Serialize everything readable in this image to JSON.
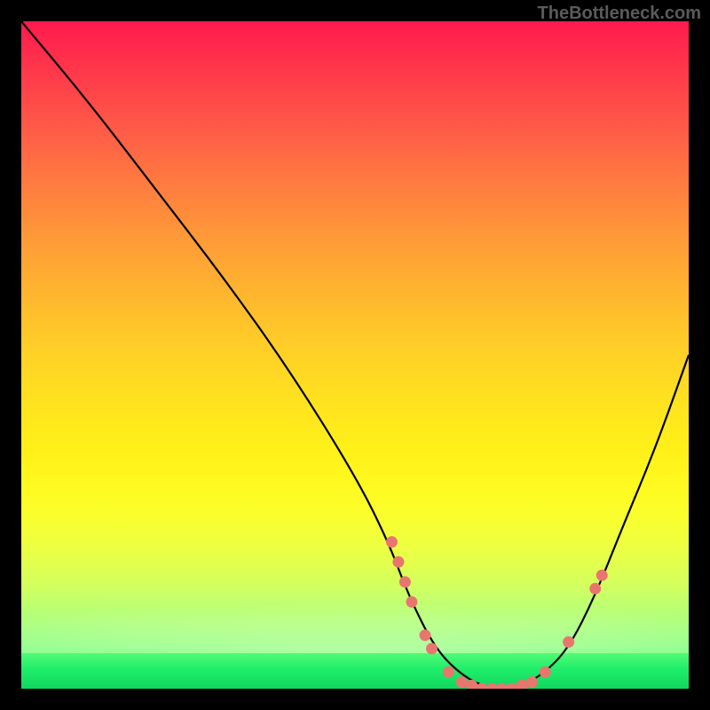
{
  "watermark": "TheBottleneck.com",
  "chart_data": {
    "type": "line",
    "title": "",
    "xlabel": "",
    "ylabel": "",
    "xlim": [
      0,
      100
    ],
    "ylim": [
      0,
      100
    ],
    "series": [
      {
        "name": "curve",
        "x": [
          0,
          10,
          20,
          30,
          40,
          50,
          55,
          58,
          62,
          66,
          70,
          74,
          78,
          82,
          86,
          90,
          95,
          100
        ],
        "y": [
          100,
          88,
          75,
          62,
          48,
          32,
          22,
          14,
          6,
          2,
          0,
          0,
          2,
          6,
          14,
          24,
          36,
          50
        ]
      }
    ],
    "points": [
      {
        "x": 55.5,
        "y": 22
      },
      {
        "x": 56.5,
        "y": 19
      },
      {
        "x": 57.5,
        "y": 16
      },
      {
        "x": 58.5,
        "y": 13
      },
      {
        "x": 60.5,
        "y": 8
      },
      {
        "x": 61.5,
        "y": 6
      },
      {
        "x": 64,
        "y": 2.5
      },
      {
        "x": 66,
        "y": 1
      },
      {
        "x": 67.5,
        "y": 0.5
      },
      {
        "x": 69,
        "y": 0
      },
      {
        "x": 70.5,
        "y": 0
      },
      {
        "x": 72,
        "y": 0
      },
      {
        "x": 73.5,
        "y": 0
      },
      {
        "x": 75,
        "y": 0.5
      },
      {
        "x": 76.5,
        "y": 1
      },
      {
        "x": 78.5,
        "y": 2.5
      },
      {
        "x": 82,
        "y": 7
      },
      {
        "x": 86,
        "y": 15
      },
      {
        "x": 87,
        "y": 17
      }
    ],
    "colors": {
      "curve": "#000000",
      "dots": "#e8766f",
      "gradient_top": "#ff1a4d",
      "gradient_mid": "#ffe020",
      "gradient_bottom": "#10d85e"
    }
  }
}
